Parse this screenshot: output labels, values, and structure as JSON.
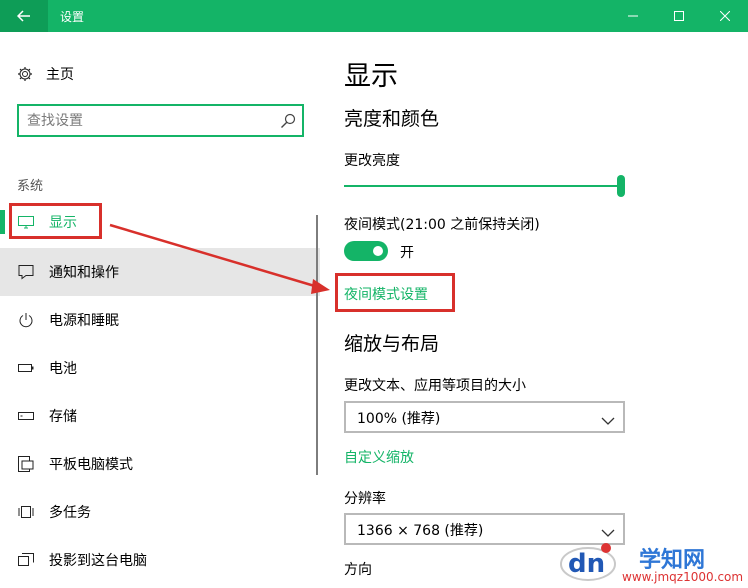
{
  "window": {
    "title": "设置"
  },
  "sidebar": {
    "home_label": "主页",
    "search_placeholder": "查找设置",
    "section_label": "系统",
    "items": [
      {
        "label": "显示",
        "icon": "monitor-icon",
        "active": true
      },
      {
        "label": "通知和操作",
        "icon": "notification-icon",
        "hover": true
      },
      {
        "label": "电源和睡眠",
        "icon": "power-icon"
      },
      {
        "label": "电池",
        "icon": "battery-icon"
      },
      {
        "label": "存储",
        "icon": "storage-icon"
      },
      {
        "label": "平板电脑模式",
        "icon": "tablet-icon"
      },
      {
        "label": "多任务",
        "icon": "multitask-icon"
      },
      {
        "label": "投影到这台电脑",
        "icon": "project-icon"
      }
    ]
  },
  "main": {
    "title": "显示",
    "brightness_section": "亮度和颜色",
    "brightness_label": "更改亮度",
    "brightness_value": 1.0,
    "night_light_label": "夜间模式(21:00 之前保持关闭)",
    "night_light_state": "开",
    "night_light_on": true,
    "night_light_link": "夜间模式设置",
    "scale_section": "缩放与布局",
    "scale_label": "更改文本、应用等项目的大小",
    "scale_value": "100% (推荐)",
    "custom_scale_link": "自定义缩放",
    "resolution_label": "分辨率",
    "resolution_value": "1366 × 768 (推荐)",
    "orientation_label": "方向"
  },
  "watermark": {
    "logo_text": "dn",
    "title": "学知网",
    "url": "www.jmqz1000.com"
  },
  "colors": {
    "accent": "#14b467",
    "annotation": "#d8302b"
  }
}
